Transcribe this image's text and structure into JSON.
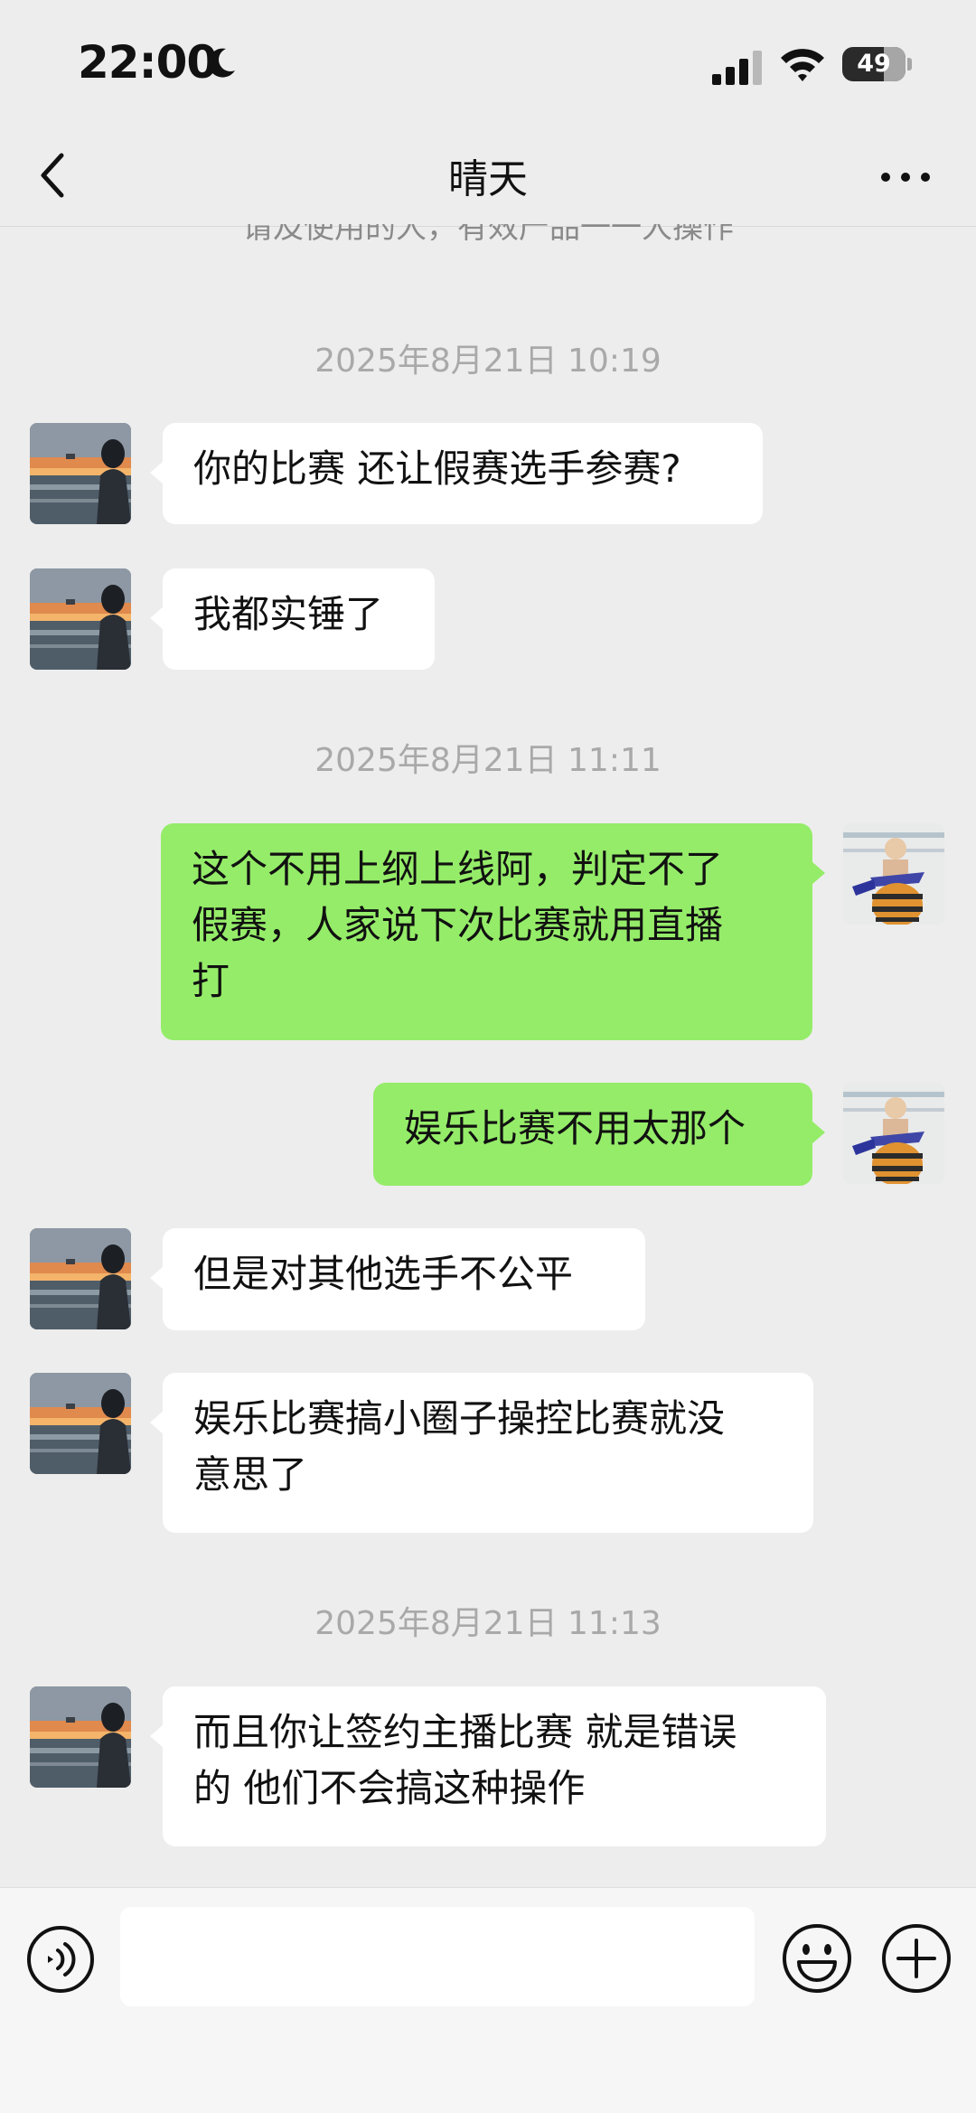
{
  "status_bar": {
    "time": "22:00",
    "battery": "49"
  },
  "header": {
    "title": "晴天"
  },
  "clipped_previous_text": "请及使用的人，有效产品一一人操作",
  "messages": [
    {
      "type": "time",
      "text": "2025年8月21日 10:19"
    },
    {
      "type": "in",
      "text": "你的比赛 还让假赛选手参赛?"
    },
    {
      "type": "in",
      "text": "我都实锤了"
    },
    {
      "type": "time",
      "text": "2025年8月21日 11:11"
    },
    {
      "type": "out",
      "lines": [
        "这个不用上纲上线阿，判定不了",
        "假赛，人家说下次比赛就用直播",
        "打"
      ]
    },
    {
      "type": "out",
      "text": "娱乐比赛不用太那个"
    },
    {
      "type": "in",
      "text": "但是对其他选手不公平"
    },
    {
      "type": "in",
      "lines": [
        "娱乐比赛搞小圈子操控比赛就没",
        "意思了"
      ]
    },
    {
      "type": "time",
      "text": "2025年8月21日 11:13"
    },
    {
      "type": "in",
      "lines": [
        "而且你让签约主播比赛 就是错误",
        "的 他们不会搞这种操作"
      ]
    }
  ],
  "input": {
    "value": "",
    "placeholder": ""
  },
  "icons": {
    "back": "chevron-left-icon",
    "more": "more-dots-icon",
    "voice": "voice-icon",
    "emoji": "emoji-icon",
    "plus": "plus-icon"
  },
  "colors": {
    "outgoing_bubble": "#95ec69",
    "incoming_bubble": "#ffffff",
    "background": "#ededed"
  }
}
